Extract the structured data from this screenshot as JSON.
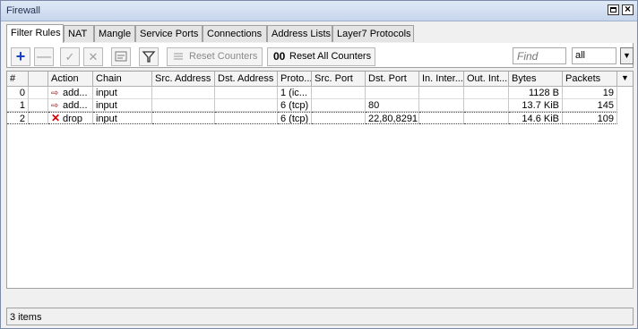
{
  "window": {
    "title": "Firewall"
  },
  "tabs": [
    "Filter Rules",
    "NAT",
    "Mangle",
    "Service Ports",
    "Connections",
    "Address Lists",
    "Layer7 Protocols"
  ],
  "toolbar": {
    "reset_counters": "Reset Counters",
    "reset_all_counters": "Reset All Counters",
    "reset_all_icon_text": "00",
    "find_placeholder": "Find",
    "filter_value": "all"
  },
  "columns": [
    "#",
    "",
    "Action",
    "Chain",
    "Src. Address",
    "Dst. Address",
    "Proto...",
    "Src. Port",
    "Dst. Port",
    "In. Inter...",
    "Out. Int...",
    "Bytes",
    "Packets"
  ],
  "rows": [
    {
      "num": "0",
      "action_icon": "add-to-list-icon",
      "action": "add...",
      "chain": "input",
      "src_address": "",
      "dst_address": "",
      "protocol": "1 (ic...",
      "src_port": "",
      "dst_port": "",
      "in_interface": "",
      "out_interface": "",
      "bytes": "1128 B",
      "packets": "19"
    },
    {
      "num": "1",
      "action_icon": "add-to-list-icon",
      "action": "add...",
      "chain": "input",
      "src_address": "",
      "dst_address": "",
      "protocol": "6 (tcp)",
      "src_port": "",
      "dst_port": "80",
      "in_interface": "",
      "out_interface": "",
      "bytes": "13.7 KiB",
      "packets": "145"
    },
    {
      "num": "2",
      "action_icon": "drop-icon",
      "action": "drop",
      "chain": "input",
      "src_address": "",
      "dst_address": "",
      "protocol": "6 (tcp)",
      "src_port": "",
      "dst_port": "22,80,8291",
      "in_interface": "",
      "out_interface": "",
      "bytes": "14.6 KiB",
      "packets": "109"
    }
  ],
  "status": {
    "items": "3 items"
  },
  "colors": {
    "drop_icon": "#d40000",
    "add_icon": "#1a3fbf",
    "titlebar": "#c7d6ec"
  }
}
